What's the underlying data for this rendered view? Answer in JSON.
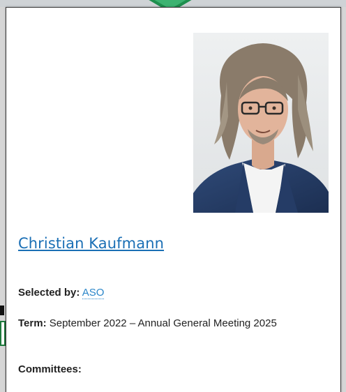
{
  "profile": {
    "name": "Christian Kaufmann",
    "selected_by_label": "Selected by:",
    "selected_by_value": "ASO",
    "term_label": "Term:",
    "term_value": "September 2022 – Annual General Meeting 2025",
    "committees_label": "Committees:",
    "photo_icon": "portrait-photo"
  },
  "colors": {
    "link": "#1a6fb5",
    "accent_arrow": "#3cb371"
  }
}
